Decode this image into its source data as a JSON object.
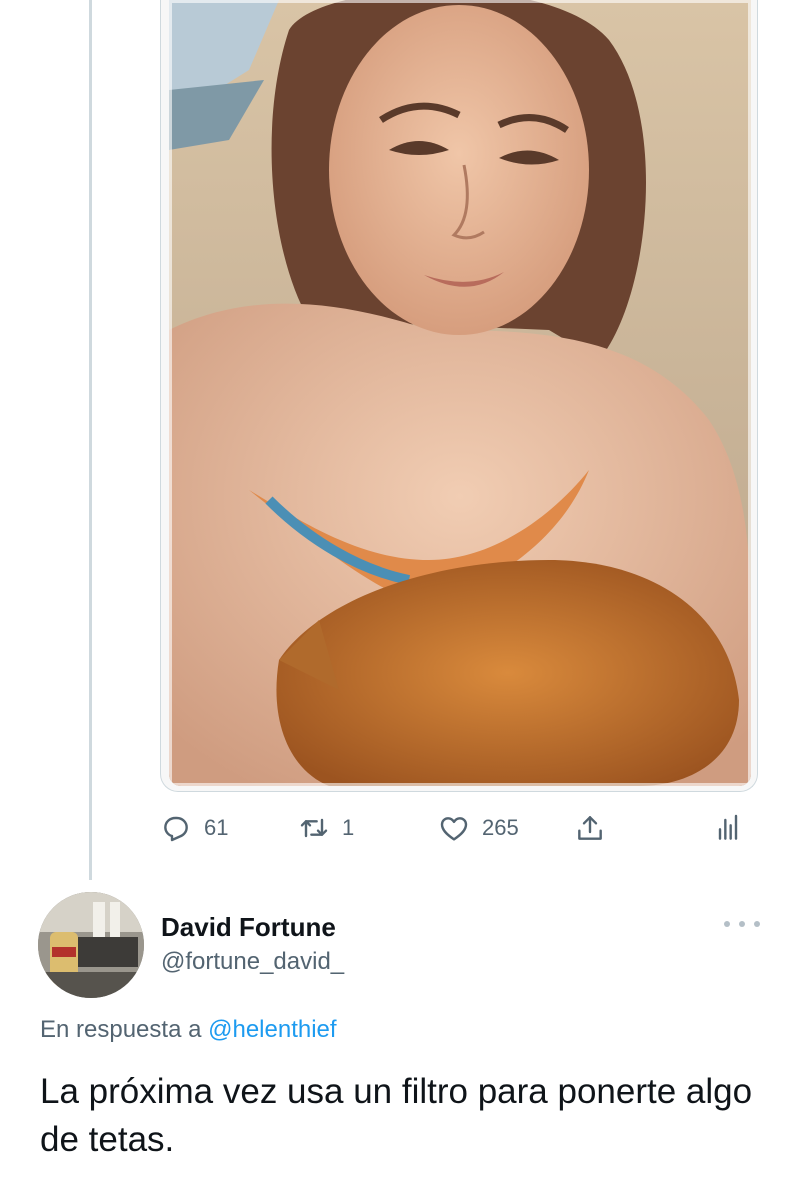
{
  "original_tweet": {
    "media_alt": "Selfie of a freckled woman at the beach holding an orange dog",
    "stats": {
      "replies": "61",
      "retweets": "1",
      "likes": "265"
    }
  },
  "reply": {
    "display_name": "David Fortune",
    "handle": "@fortune_david_",
    "in_reply_to_prefix": "En respuesta a",
    "in_reply_to_handle": "@helenthief",
    "text": "La próxima vez usa un filtro para ponerte algo de tetas."
  },
  "colors": {
    "text_primary": "#0f1419",
    "text_secondary": "#536471",
    "link": "#1d9bf0",
    "divider": "#cfd9de"
  },
  "icons": {
    "reply": "reply-icon",
    "retweet": "retweet-icon",
    "like": "heart-icon",
    "share": "share-icon",
    "analytics": "analytics-icon",
    "more": "more-icon"
  }
}
